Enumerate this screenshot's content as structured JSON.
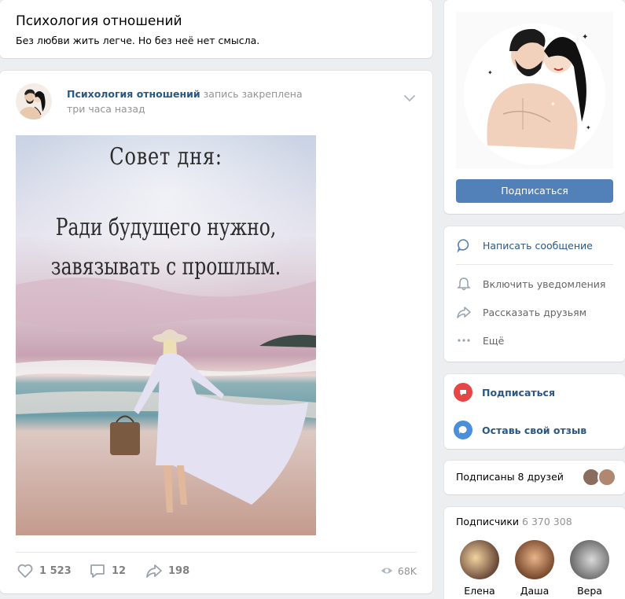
{
  "header": {
    "title": "Психология отношений",
    "status": "Без любви жить легче. Но без неё нет смысла."
  },
  "post": {
    "author": "Психология отношений",
    "pinned_label": "запись закреплена",
    "time": "три часа назад",
    "image_text": {
      "line1": "Совет дня:",
      "line2": "Ради будущего нужно,",
      "line3": "завязывать с прошлым."
    },
    "likes": "1 523",
    "comments": "12",
    "shares": "198",
    "views": "68K"
  },
  "sidebar": {
    "subscribe_button": "Подписаться",
    "actions": [
      {
        "label": "Написать сообщение",
        "icon": "message-icon"
      },
      {
        "label": "Включить уведомления",
        "icon": "bell-icon"
      },
      {
        "label": "Рассказать друзьям",
        "icon": "share-icon"
      },
      {
        "label": "Ещё",
        "icon": "more-icon"
      }
    ],
    "widgets": [
      {
        "label": "Подписаться",
        "icon": "subscribe-widget-icon",
        "color": "#e64646"
      },
      {
        "label": "Оставь свой отзыв",
        "icon": "feedback-icon",
        "color": "#4a8fd9"
      }
    ],
    "friends_text": "Подписаны 8 друзей",
    "subscribers": {
      "title": "Подписчики",
      "count": "6 370 308",
      "people": [
        "Елена",
        "Даша",
        "Вера"
      ]
    }
  },
  "colors": {
    "link": "#2a5885",
    "button": "#5181b8",
    "muted": "#939393"
  }
}
